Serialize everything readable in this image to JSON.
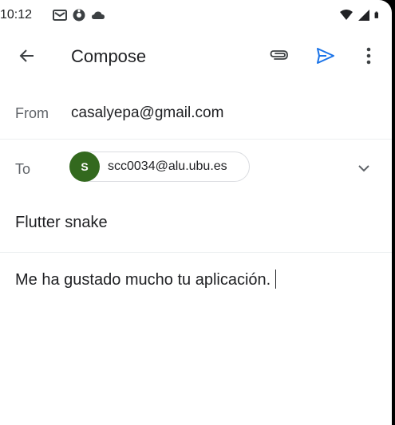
{
  "status_bar": {
    "time": "10:12",
    "left_icons": [
      "gmail-icon",
      "vpn-icon",
      "cloud-icon"
    ],
    "right_icons": [
      "wifi-icon",
      "signal-icon",
      "battery-icon"
    ]
  },
  "app_bar": {
    "title": "Compose",
    "accent_color": "#1a73e8"
  },
  "from": {
    "label": "From",
    "value": "casalyepa@gmail.com"
  },
  "to": {
    "label": "To",
    "recipients": [
      {
        "initial": "S",
        "email": "scc0034@alu.ubu.es",
        "avatar_color": "#33691e"
      }
    ]
  },
  "subject": {
    "value": "Flutter snake"
  },
  "body": {
    "text": "Me ha gustado mucho tu aplicación."
  }
}
